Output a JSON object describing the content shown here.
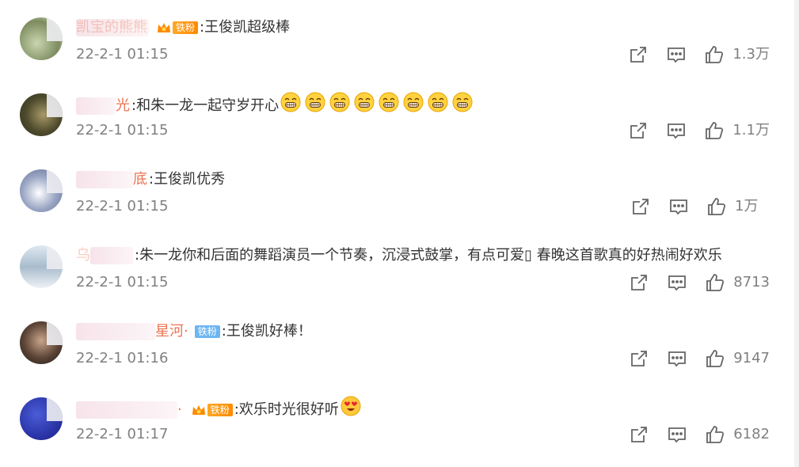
{
  "comments": [
    {
      "username": "凯宝的熊熊",
      "badge": "铁粉",
      "badge_style": "orange",
      "text": "王俊凯超级棒",
      "emoji_count": 0,
      "time": "22-2-1 01:15",
      "likes": "1.3万"
    },
    {
      "username": "光",
      "badge": "",
      "text": "和朱一龙一起守岁开心",
      "emoji_count": 8,
      "emoji_name": "grin-emoji",
      "time": "22-2-1 01:15",
      "likes": "1.1万"
    },
    {
      "username": "底",
      "badge": "",
      "text": "王俊凯优秀",
      "emoji_count": 0,
      "time": "22-2-1 01:15",
      "likes": "1万"
    },
    {
      "username": "乌",
      "badge": "",
      "text": "朱一龙你和后面的舞蹈演员一个节奏，沉浸式鼓掌，有点可爱▯ 春晚这首歌真的好热闹好欢乐",
      "emoji_count": 0,
      "time": "22-2-1 01:15",
      "likes": "8713"
    },
    {
      "username": "星河·",
      "badge": "铁粉",
      "badge_style": "blue",
      "text": "王俊凯好棒！",
      "emoji_count": 0,
      "time": "22-2-1 01:16",
      "likes": "9147"
    },
    {
      "username": "·",
      "badge": "铁粉",
      "badge_style": "orange",
      "text": "欢乐时光很好听",
      "emoji_count": 1,
      "emoji_name": "heart-eyes-emoji",
      "time": "22-2-1 01:17",
      "likes": "6182"
    }
  ],
  "colors": {
    "username": "#eb7350",
    "meta_gray": "#808080",
    "badge_orange": "#ff9a1f",
    "badge_blue": "#6cb6f2"
  }
}
